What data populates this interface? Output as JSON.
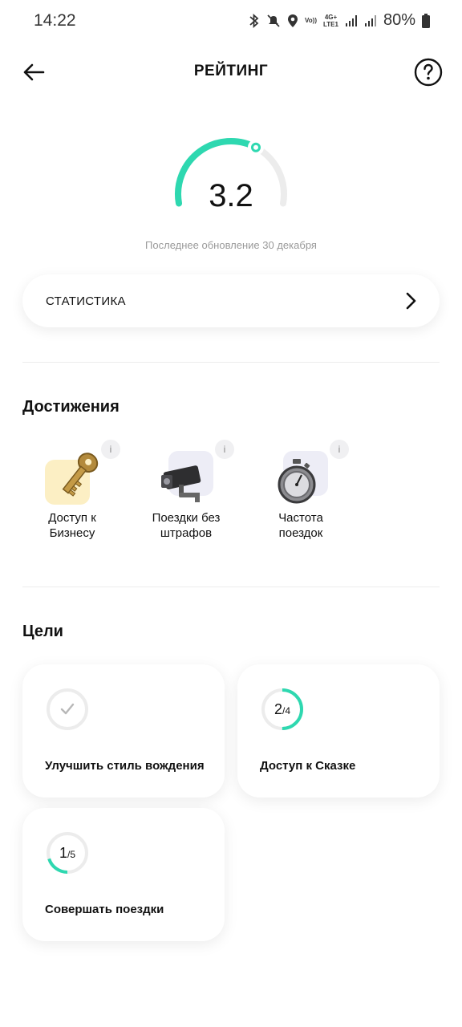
{
  "status_bar": {
    "time": "14:22",
    "net_top": "Vo))",
    "net_bottom": "LTE1",
    "net_type": "4G+",
    "battery": "80%"
  },
  "header": {
    "title": "РЕЙТИНГ"
  },
  "rating": {
    "value": "3.2",
    "max": 5,
    "last_update": "Последнее обновление 30 декабря"
  },
  "statistics": {
    "label": "СТАТИСТИКА"
  },
  "achievements": {
    "title": "Достижения",
    "info_glyph": "i",
    "items": [
      {
        "line1": "Доступ к",
        "line2": "Бизнесу",
        "icon": "key-icon",
        "tile_color": "#fcefc4"
      },
      {
        "line1": "Поездки без",
        "line2": "штрафов",
        "icon": "camera-icon",
        "tile_color": "#ededf6"
      },
      {
        "line1": "Частота",
        "line2": "поездок",
        "icon": "stopwatch-icon",
        "tile_color": "#ededf6"
      }
    ]
  },
  "goals": {
    "title": "Цели",
    "items": [
      {
        "label": "Улучшить стиль вождения",
        "done": true,
        "progress": 0
      },
      {
        "label": "Доступ к Сказке",
        "current": "2",
        "total": "/4",
        "progress": 0.5
      },
      {
        "label": "Совершать поездки",
        "current": "1",
        "total": "/5",
        "progress": 0.2
      }
    ]
  },
  "colors": {
    "accent": "#2ed8b0",
    "track": "#ececec",
    "muted": "#9a9a9a"
  }
}
